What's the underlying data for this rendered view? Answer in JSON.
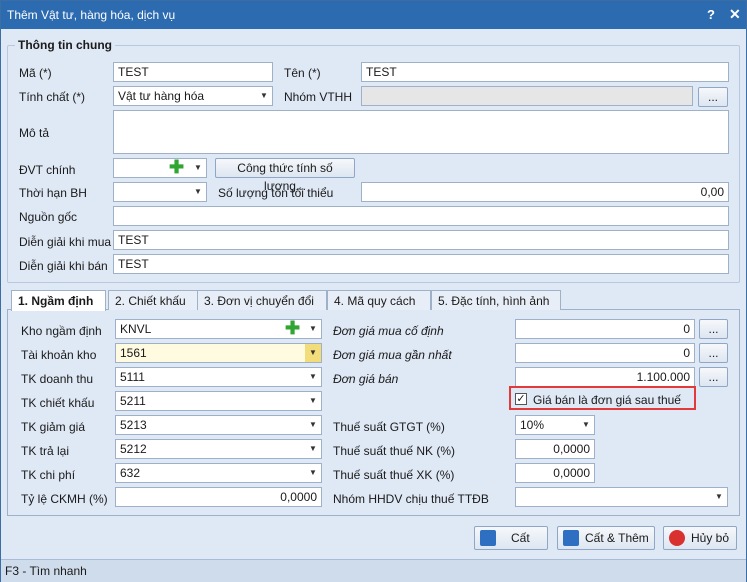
{
  "window": {
    "title": "Thêm Vật tư, hàng hóa, dịch vụ",
    "help": "?",
    "close": "✕"
  },
  "general": {
    "title": "Thông tin chung",
    "code_label": "Mã (*)",
    "code_value": "TEST",
    "name_label": "Tên (*)",
    "name_value": "TEST",
    "nature_label": "Tính chất (*)",
    "nature_value": "Vật tư hàng hóa",
    "group_label": "Nhóm VTHH",
    "group_value": "",
    "group_btn": "...",
    "desc_label": "Mô tả",
    "desc_value": "",
    "unit_label": "ĐVT chính",
    "unit_value": "",
    "qty_formula_btn": "Công thức tính số lượng...",
    "warranty_label": "Thời hạn BH",
    "warranty_value": "",
    "min_stock_label": "Số lượng tồn tối thiểu",
    "min_stock_value": "0,00",
    "origin_label": "Nguồn gốc",
    "origin_value": "",
    "buy_desc_label": "Diễn giải khi mua",
    "buy_desc_value": "TEST",
    "sell_desc_label": "Diễn giải khi bán",
    "sell_desc_value": "TEST"
  },
  "tabs": [
    {
      "label": "1. Ngầm định"
    },
    {
      "label": "2. Chiết khấu"
    },
    {
      "label": "3. Đơn vị chuyển đổi"
    },
    {
      "label": "4. Mã quy cách"
    },
    {
      "label": "5. Đặc tính, hình ảnh"
    }
  ],
  "defaults": {
    "warehouse_label": "Kho ngầm định",
    "warehouse_value": "KNVL",
    "stock_acc_label": "Tài khoản kho",
    "stock_acc_value": "1561",
    "revenue_acc_label": "TK doanh thu",
    "revenue_acc_value": "5111",
    "discount_acc_label": "TK chiết khấu",
    "discount_acc_value": "5211",
    "reduction_acc_label": "TK giảm giá",
    "reduction_acc_value": "5213",
    "return_acc_label": "TK trả lại",
    "return_acc_value": "5212",
    "expense_acc_label": "TK chi phí",
    "expense_acc_value": "632",
    "ckmh_label": "Tỷ lệ CKMH (%)",
    "ckmh_value": "0,0000",
    "fixed_price_label": "Đơn giá mua cố định",
    "fixed_price_value": "0",
    "last_price_label": "Đơn giá mua gần nhất",
    "last_price_value": "0",
    "sale_price_label": "Đơn giá bán",
    "sale_price_value": "1.100.000",
    "after_tax_label": "Giá bán là đơn giá sau thuế",
    "after_tax_checked": "✓",
    "vat_label": "Thuế suất GTGT (%)",
    "vat_value": "10%",
    "import_tax_label": "Thuế suất thuế NK (%)",
    "import_tax_value": "0,0000",
    "export_tax_label": "Thuế suất thuế XK (%)",
    "export_tax_value": "0,0000",
    "ttdb_label": "Nhóm HHDV chịu thuế TTĐB",
    "ttdb_value": "",
    "dots": "..."
  },
  "footer": {
    "save": "Cất",
    "save_add": "Cất & Thêm",
    "cancel": "Hủy bỏ"
  },
  "status": {
    "hint": "F3 - Tìm nhanh"
  }
}
